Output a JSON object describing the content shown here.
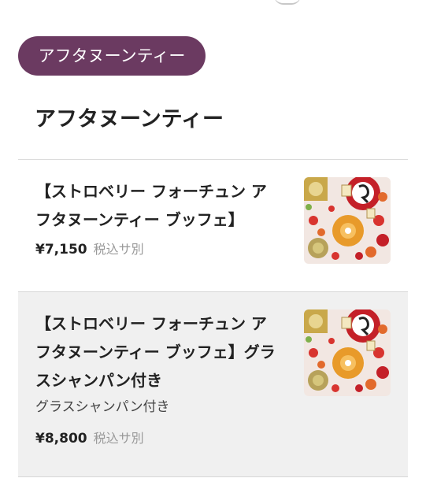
{
  "category": {
    "chip_label": "アフタヌーンティー"
  },
  "section": {
    "title": "アフタヌーンティー"
  },
  "items": [
    {
      "name": "【ストロベリー フォーチュン アフタヌーンティー ブッフェ】",
      "description": "",
      "price": "¥7,150",
      "tax_note": "税込サ別",
      "image_icon": "strawberry-buffet-photo"
    },
    {
      "name": "【ストロベリー フォーチュン アフタヌーンティー ブッフェ】グラスシャンパン付き",
      "description": "グラスシャンパン付き",
      "price": "¥8,800",
      "tax_note": "税込サ別",
      "image_icon": "strawberry-buffet-photo"
    }
  ],
  "colors": {
    "chip_background": "#6b3a61",
    "selected_row_background": "#f0f0f0",
    "tax_note": "#999999"
  }
}
